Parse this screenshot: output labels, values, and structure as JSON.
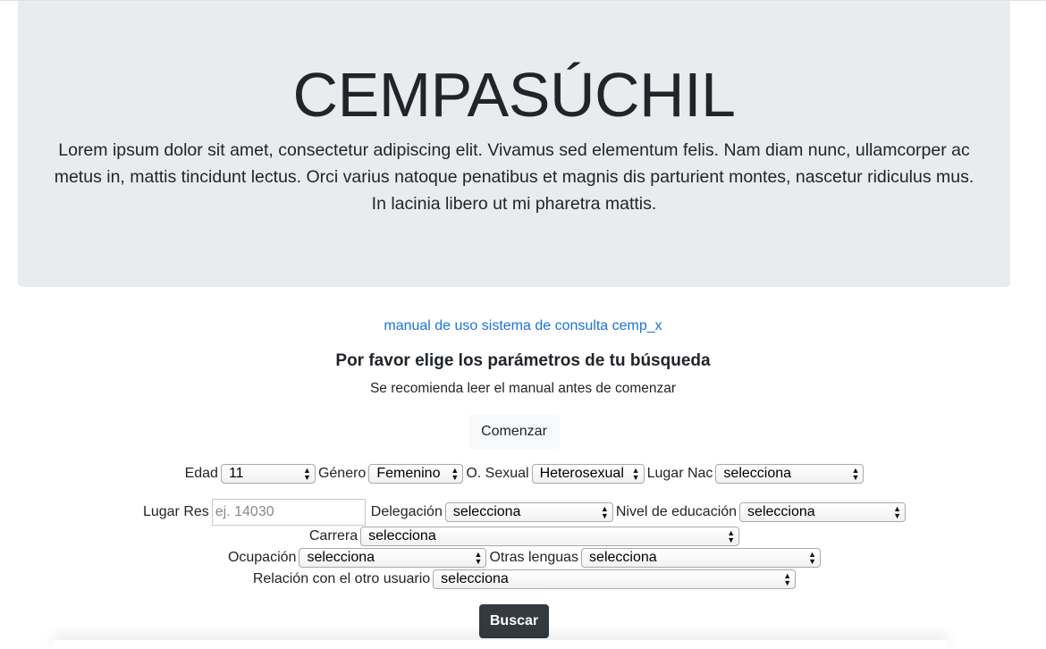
{
  "hero": {
    "title": "CEMPASÚCHIL",
    "text": "Lorem ipsum dolor sit amet, consectetur adipiscing elit. Vivamus sed elementum felis. Nam diam nunc, ullamcorper ac metus in, mattis tincidunt lectus. Orci varius natoque penatibus et magnis dis parturient montes, nascetur ridiculus mus. In lacinia libero ut mi pharetra mattis."
  },
  "manual_link": "manual de uso sistema de consulta cemp_x",
  "subtitle": "Por favor elige los parámetros de tu búsqueda",
  "recommendation": "Se recomienda leer el manual antes de comenzar",
  "start_button": "Comenzar",
  "filters": {
    "edad": {
      "label": "Edad",
      "value": "11"
    },
    "genero": {
      "label": "Género",
      "value": "Femenino"
    },
    "orientacion": {
      "label": "O. Sexual",
      "value": "Heterosexual"
    },
    "lugar_nac": {
      "label": "Lugar Nac",
      "value": "selecciona"
    },
    "lugar_res": {
      "label": "Lugar Res",
      "placeholder": "ej. 14030"
    },
    "delegacion": {
      "label": "Delegación",
      "value": "selecciona"
    },
    "nivel_educacion": {
      "label": "Nivel de educación",
      "value": "selecciona"
    },
    "carrera": {
      "label": "Carrera",
      "value": "selecciona"
    },
    "ocupacion": {
      "label": "Ocupación",
      "value": "selecciona"
    },
    "otras_lenguas": {
      "label": "Otras lenguas",
      "value": "selecciona"
    },
    "relacion": {
      "label": "Relación con el otro usuario",
      "value": "selecciona"
    }
  },
  "search_button": "Buscar",
  "colors": {
    "jumbotron_bg": "#e9ecef",
    "link": "#1a73d9",
    "dark_button": "#343a40",
    "light_button": "#f8f9fa"
  }
}
